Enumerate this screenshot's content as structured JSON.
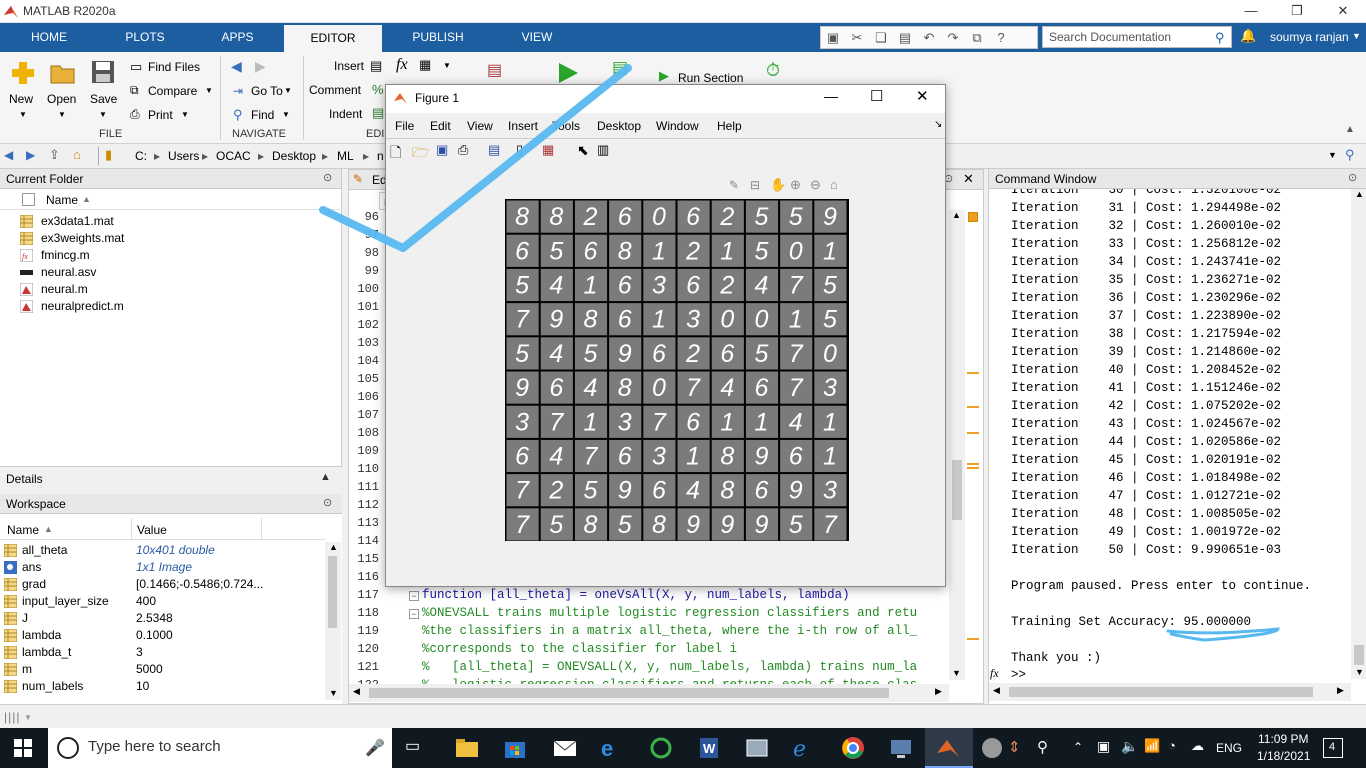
{
  "app": {
    "title": "MATLAB R2020a"
  },
  "tabs": [
    "HOME",
    "PLOTS",
    "APPS",
    "EDITOR",
    "PUBLISH",
    "VIEW"
  ],
  "search": {
    "placeholder": "Search Documentation"
  },
  "user": "soumya ranjan",
  "ribbon": {
    "new_label": "New",
    "open_label": "Open",
    "save_label": "Save",
    "find_files": "Find Files",
    "compare": "Compare",
    "print": "Print",
    "file_section": "FILE",
    "goto": "Go To",
    "find": "Find",
    "navigate_section": "NAVIGATE",
    "insert": "Insert",
    "comment": "Comment",
    "indent": "Indent",
    "edit_section": "EDI",
    "run_section": "Run Section"
  },
  "address": {
    "segments": [
      "C:",
      "Users",
      "OCAC",
      "Desktop",
      "ML",
      "n"
    ]
  },
  "current_folder": {
    "title": "Current Folder",
    "col_name": "Name",
    "files": [
      "ex3data1.mat",
      "ex3weights.mat",
      "fmincg.m",
      "neural.asv",
      "neural.m",
      "neuralpredict.m"
    ]
  },
  "details": {
    "title": "Details"
  },
  "workspace": {
    "title": "Workspace",
    "col_name": "Name",
    "col_value": "Value",
    "rows": [
      {
        "name": "all_theta",
        "value": "10x401 double"
      },
      {
        "name": "ans",
        "value": "1x1 Image"
      },
      {
        "name": "grad",
        "value": "[0.1466;-0.5486;0.724..."
      },
      {
        "name": "input_layer_size",
        "value": "400"
      },
      {
        "name": "J",
        "value": "2.5348"
      },
      {
        "name": "lambda",
        "value": "0.1000"
      },
      {
        "name": "lambda_t",
        "value": "3"
      },
      {
        "name": "m",
        "value": "5000"
      },
      {
        "name": "num_labels",
        "value": "10"
      }
    ]
  },
  "editor": {
    "tab_label": "Ed",
    "tab_file": "n",
    "line_numbers": [
      "96",
      "97",
      "98",
      "99",
      "100",
      "101",
      "102",
      "103",
      "104",
      "105",
      "106",
      "107",
      "108",
      "109",
      "110",
      "111",
      "112",
      "113",
      "114",
      "115",
      "116",
      "117",
      "118",
      "119",
      "120",
      "121",
      "122"
    ],
    "code_lines": [
      "function [all_theta] = oneVsAll(X, y, num_labels, lambda)",
      "%ONEVSALL trains multiple logistic regression classifiers and retu",
      "%the classifiers in a matrix all_theta, where the i-th row of all_",
      "%corresponds to the classifier for label i",
      "%   [all_theta] = ONEVSALL(X, y, num_labels, lambda) trains num_la",
      "%   logistic regression classifiers and returns each of these clas"
    ]
  },
  "figure": {
    "title": "Figure 1",
    "menu": [
      "File",
      "Edit",
      "View",
      "Insert",
      "Tools",
      "Desktop",
      "Window",
      "Help"
    ],
    "digits": [
      [
        "8",
        "8",
        "2",
        "6",
        "0",
        "6",
        "2",
        "5",
        "5",
        "9"
      ],
      [
        "6",
        "5",
        "6",
        "8",
        "1",
        "2",
        "1",
        "5",
        "0",
        "1"
      ],
      [
        "5",
        "4",
        "1",
        "6",
        "3",
        "6",
        "2",
        "4",
        "7",
        "5"
      ],
      [
        "7",
        "9",
        "8",
        "6",
        "1",
        "3",
        "0",
        "0",
        "1",
        "5"
      ],
      [
        "5",
        "4",
        "5",
        "9",
        "6",
        "2",
        "6",
        "5",
        "7",
        "0"
      ],
      [
        "9",
        "6",
        "4",
        "8",
        "0",
        "7",
        "4",
        "6",
        "7",
        "3"
      ],
      [
        "3",
        "7",
        "1",
        "3",
        "7",
        "6",
        "1",
        "1",
        "4",
        "1"
      ],
      [
        "6",
        "4",
        "7",
        "6",
        "3",
        "1",
        "8",
        "9",
        "6",
        "1"
      ],
      [
        "7",
        "2",
        "5",
        "9",
        "6",
        "4",
        "8",
        "6",
        "9",
        "3"
      ],
      [
        "7",
        "5",
        "8",
        "5",
        "8",
        "9",
        "9",
        "9",
        "5",
        "7"
      ]
    ]
  },
  "command_window": {
    "title": "Command Window",
    "lines": [
      "Iteration    30 | Cost: 1.320100e-02",
      "Iteration    31 | Cost: 1.294498e-02",
      "Iteration    32 | Cost: 1.260010e-02",
      "Iteration    33 | Cost: 1.256812e-02",
      "Iteration    34 | Cost: 1.243741e-02",
      "Iteration    35 | Cost: 1.236271e-02",
      "Iteration    36 | Cost: 1.230296e-02",
      "Iteration    37 | Cost: 1.223890e-02",
      "Iteration    38 | Cost: 1.217594e-02",
      "Iteration    39 | Cost: 1.214860e-02",
      "Iteration    40 | Cost: 1.208452e-02",
      "Iteration    41 | Cost: 1.151246e-02",
      "Iteration    42 | Cost: 1.075202e-02",
      "Iteration    43 | Cost: 1.024567e-02",
      "Iteration    44 | Cost: 1.020586e-02",
      "Iteration    45 | Cost: 1.020191e-02",
      "Iteration    46 | Cost: 1.018498e-02",
      "Iteration    47 | Cost: 1.012721e-02",
      "Iteration    48 | Cost: 1.008505e-02",
      "Iteration    49 | Cost: 1.001972e-02",
      "Iteration    50 | Cost: 9.990651e-03",
      "",
      "Program paused. Press enter to continue.",
      "",
      "Training Set Accuracy: 95.000000",
      "",
      "Thank you :)"
    ],
    "prompt": ">>",
    "fx": "fx"
  },
  "taskbar": {
    "search_placeholder": "Type here to search",
    "time": "11:09 PM",
    "date": "1/18/2021",
    "lang": "ENG",
    "notif_count": "4"
  }
}
